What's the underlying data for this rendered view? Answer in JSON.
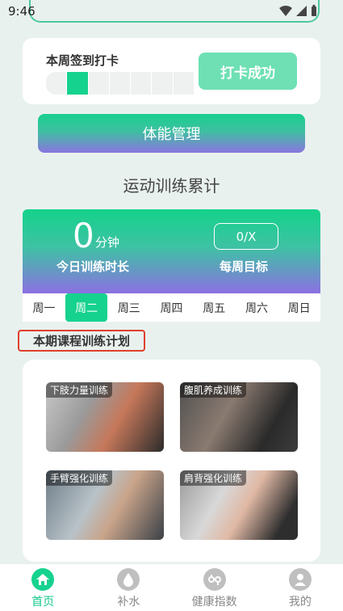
{
  "status_bar": {
    "time": "9:46"
  },
  "checkin": {
    "title": "本周签到打卡",
    "button_label": "打卡成功",
    "days_total": 7,
    "filled_day_index": 1
  },
  "fitness_button_label": "体能管理",
  "section_heading": "运动训练累计",
  "stats": {
    "today_value": "0",
    "today_unit": "分钟",
    "today_label": "今日训练时长",
    "weekly_goal": "0/X",
    "weekly_label": "每周目标"
  },
  "day_tabs": [
    {
      "label": "周一",
      "active": false
    },
    {
      "label": "周二",
      "active": true
    },
    {
      "label": "周三",
      "active": false
    },
    {
      "label": "周四",
      "active": false
    },
    {
      "label": "周五",
      "active": false
    },
    {
      "label": "周六",
      "active": false
    },
    {
      "label": "周日",
      "active": false
    }
  ],
  "plan_title": "本期课程训练计划",
  "courses": [
    {
      "label": "下肢力量训练"
    },
    {
      "label": "腹肌养成训练"
    },
    {
      "label": "手臂强化训练"
    },
    {
      "label": "肩背强化训练"
    }
  ],
  "bottom_nav": [
    {
      "label": "首页",
      "icon": "home-icon",
      "active": true
    },
    {
      "label": "补水",
      "icon": "water-drop-icon",
      "active": false
    },
    {
      "label": "健康指数",
      "icon": "health-index-icon",
      "active": false
    },
    {
      "label": "我的",
      "icon": "profile-icon",
      "active": false
    }
  ],
  "colors": {
    "accent": "#16d28f",
    "highlight_border": "#e0402d",
    "gradient_end": "#8c70e2"
  }
}
